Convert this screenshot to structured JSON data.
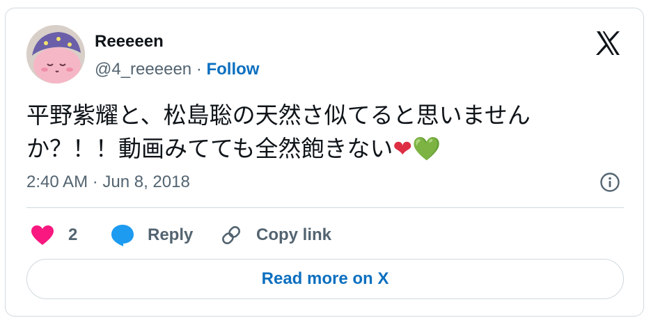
{
  "author": {
    "name": "Reeeeen",
    "handle": "@4_reeeeen",
    "separator": "·",
    "follow_label": "Follow",
    "avatar_icon": "avatar-kirby-image"
  },
  "brand": {
    "logo_icon": "x-logo-icon"
  },
  "tweet": {
    "text_line1": "平野紫耀と、松島聡の天然さ似てると思いません",
    "text_line2": "か？！！動画みてても全然飽きない",
    "emoji_red_heart": "❤",
    "emoji_green_heart": "💚",
    "timestamp": "2:40 AM · Jun 8, 2018"
  },
  "actions": {
    "like_icon": "heart-icon",
    "like_count": "2",
    "reply_icon": "reply-bubble-icon",
    "reply_label": "Reply",
    "copy_icon": "link-icon",
    "copy_label": "Copy link"
  },
  "footer": {
    "read_more_label": "Read more on X"
  },
  "colors": {
    "accent_blue": "#0c6fbf",
    "like_pink": "#f91880",
    "secondary_text": "#536471",
    "border": "#cfd9de"
  }
}
